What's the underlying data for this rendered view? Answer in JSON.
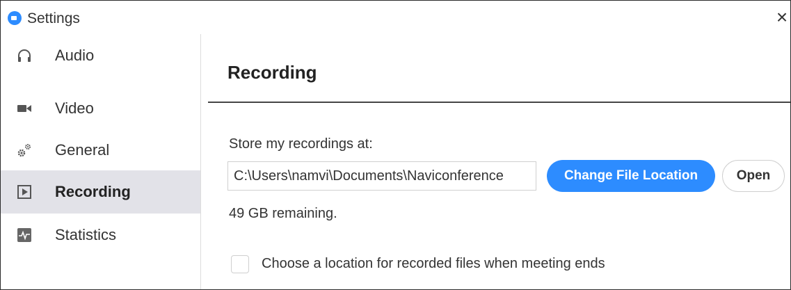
{
  "window": {
    "title": "Settings",
    "close_glyph": "×",
    "accent_color": "#2d8cff"
  },
  "sidebar": {
    "items": [
      {
        "label": "Audio",
        "icon": "headphones-icon"
      },
      {
        "label": "Video",
        "icon": "video-camera-icon"
      },
      {
        "label": "General",
        "icon": "gears-icon"
      },
      {
        "label": "Recording",
        "icon": "recording-icon",
        "active": true
      },
      {
        "label": "Statistics",
        "icon": "statistics-icon"
      }
    ]
  },
  "main": {
    "title": "Recording",
    "store_label": "Store my recordings at:",
    "path_value": "C:\\Users\\namvi\\Documents\\Naviconference",
    "change_button": "Change File Location",
    "open_button": "Open",
    "remaining": "49 GB remaining.",
    "choose_location_label": "Choose a location for recorded files when meeting ends",
    "choose_location_checked": false
  }
}
